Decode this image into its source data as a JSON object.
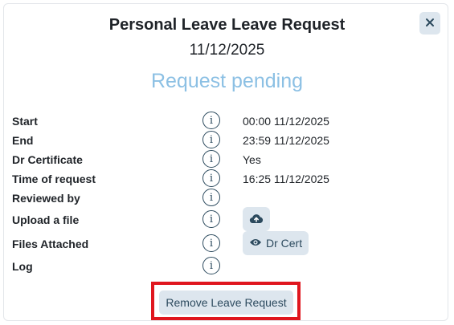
{
  "dialog": {
    "title": "Personal Leave Leave Request",
    "date": "11/12/2025",
    "status": "Request pending",
    "close_icon": "close-icon"
  },
  "fields": {
    "start": {
      "label": "Start",
      "value": "00:00 11/12/2025"
    },
    "end": {
      "label": "End",
      "value": "23:59 11/12/2025"
    },
    "dr_cert": {
      "label": "Dr Certificate",
      "value": "Yes"
    },
    "requested": {
      "label": "Time of request",
      "value": "16:25 11/12/2025"
    },
    "reviewed": {
      "label": "Reviewed by",
      "value": ""
    },
    "upload": {
      "label": "Upload a file",
      "icon": "cloud-upload-icon"
    },
    "files": {
      "label": "Files Attached",
      "file_label": "Dr Cert",
      "icon": "eye-icon"
    },
    "log": {
      "label": "Log"
    }
  },
  "info_icon_glyph": "i",
  "actions": {
    "remove_label": "Remove Leave Request"
  },
  "colors": {
    "status": "#8cc0e4",
    "button_bg": "#dde6ee",
    "button_text": "#2c4a5e",
    "highlight": "#e0161e"
  }
}
